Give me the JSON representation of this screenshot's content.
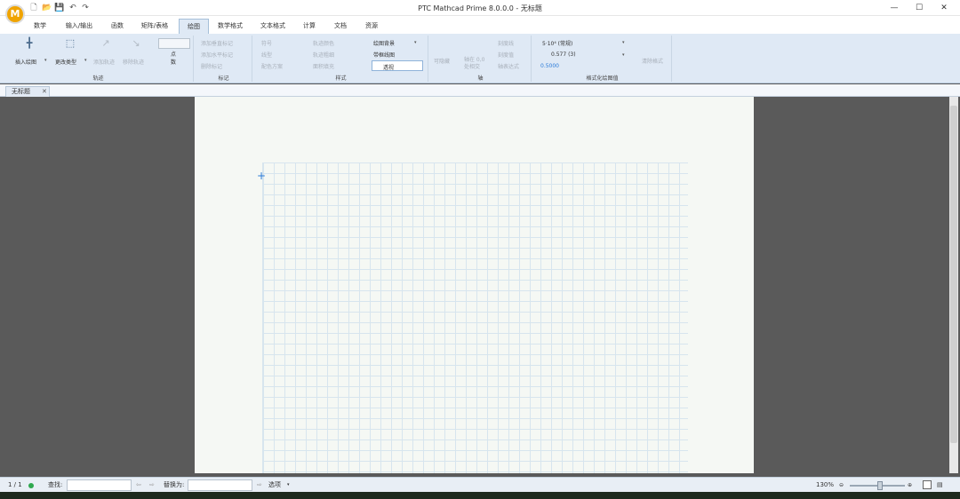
{
  "window": {
    "title": "PTC Mathcad Prime 8.0.0.0 - 无标题",
    "logo": "M",
    "minimize": "—",
    "maximize": "☐",
    "close": "✕"
  },
  "quick_access": {
    "new": "🗋",
    "open": "📂",
    "save": "💾",
    "undo": "↶",
    "redo": "↷"
  },
  "tabs": [
    "数学",
    "输入/输出",
    "函数",
    "矩阵/表格",
    "绘图",
    "数学格式",
    "文本格式",
    "计算",
    "文档",
    "资源"
  ],
  "active_tab": "绘图",
  "ribbon": {
    "trace": {
      "label": "轨迹",
      "insert_plot": "插入绘图",
      "change_type": "更改类型",
      "add_trace": "添加轨迹",
      "remove_trace": "移除轨迹",
      "points": "点\n数",
      "insert_icon": "╋",
      "change_icon": "⬚",
      "add_icon": "↗",
      "remove_icon": "↘"
    },
    "marker": {
      "label": "标记",
      "add_vertical": "添加垂直标记",
      "add_horizontal": "添加水平标记",
      "delete": "删除标记"
    },
    "style": {
      "label": "样式",
      "symbol": "符号",
      "line_type": "线型",
      "color_scheme": "配色方案",
      "trace_color": "轨迹颜色",
      "trace_weight": "轨迹粗细",
      "area_fill": "面积填充",
      "plot_background": "绘图背景",
      "bounding_lines": "带框线图",
      "transparency": "透视"
    },
    "axis": {
      "label": "轴",
      "hide_arrows": "可隐藏",
      "axis_origin": "轴在 0,0 处相交",
      "tick_marks": "刻度线",
      "tick_values": "刻度值",
      "tick_expr": "轴表达式"
    },
    "format": {
      "label": "格式化绘图值",
      "value1": "5·10⁴ (常规)",
      "value2": "0.577 (3)",
      "value3": "0.5000",
      "clear": "清除格式"
    }
  },
  "document_tab": {
    "name": "无标题",
    "close": "✕"
  },
  "statusbar": {
    "page": "1 / 1",
    "find_label": "查找:",
    "replace_label": "替换为:",
    "options": "选项",
    "zoom": "130%",
    "find_value": "",
    "replace_value": ""
  },
  "colors": {
    "accent": "#2b7bd8",
    "ribbon": "#dfe9f5",
    "grid": "#d7e5ee"
  }
}
